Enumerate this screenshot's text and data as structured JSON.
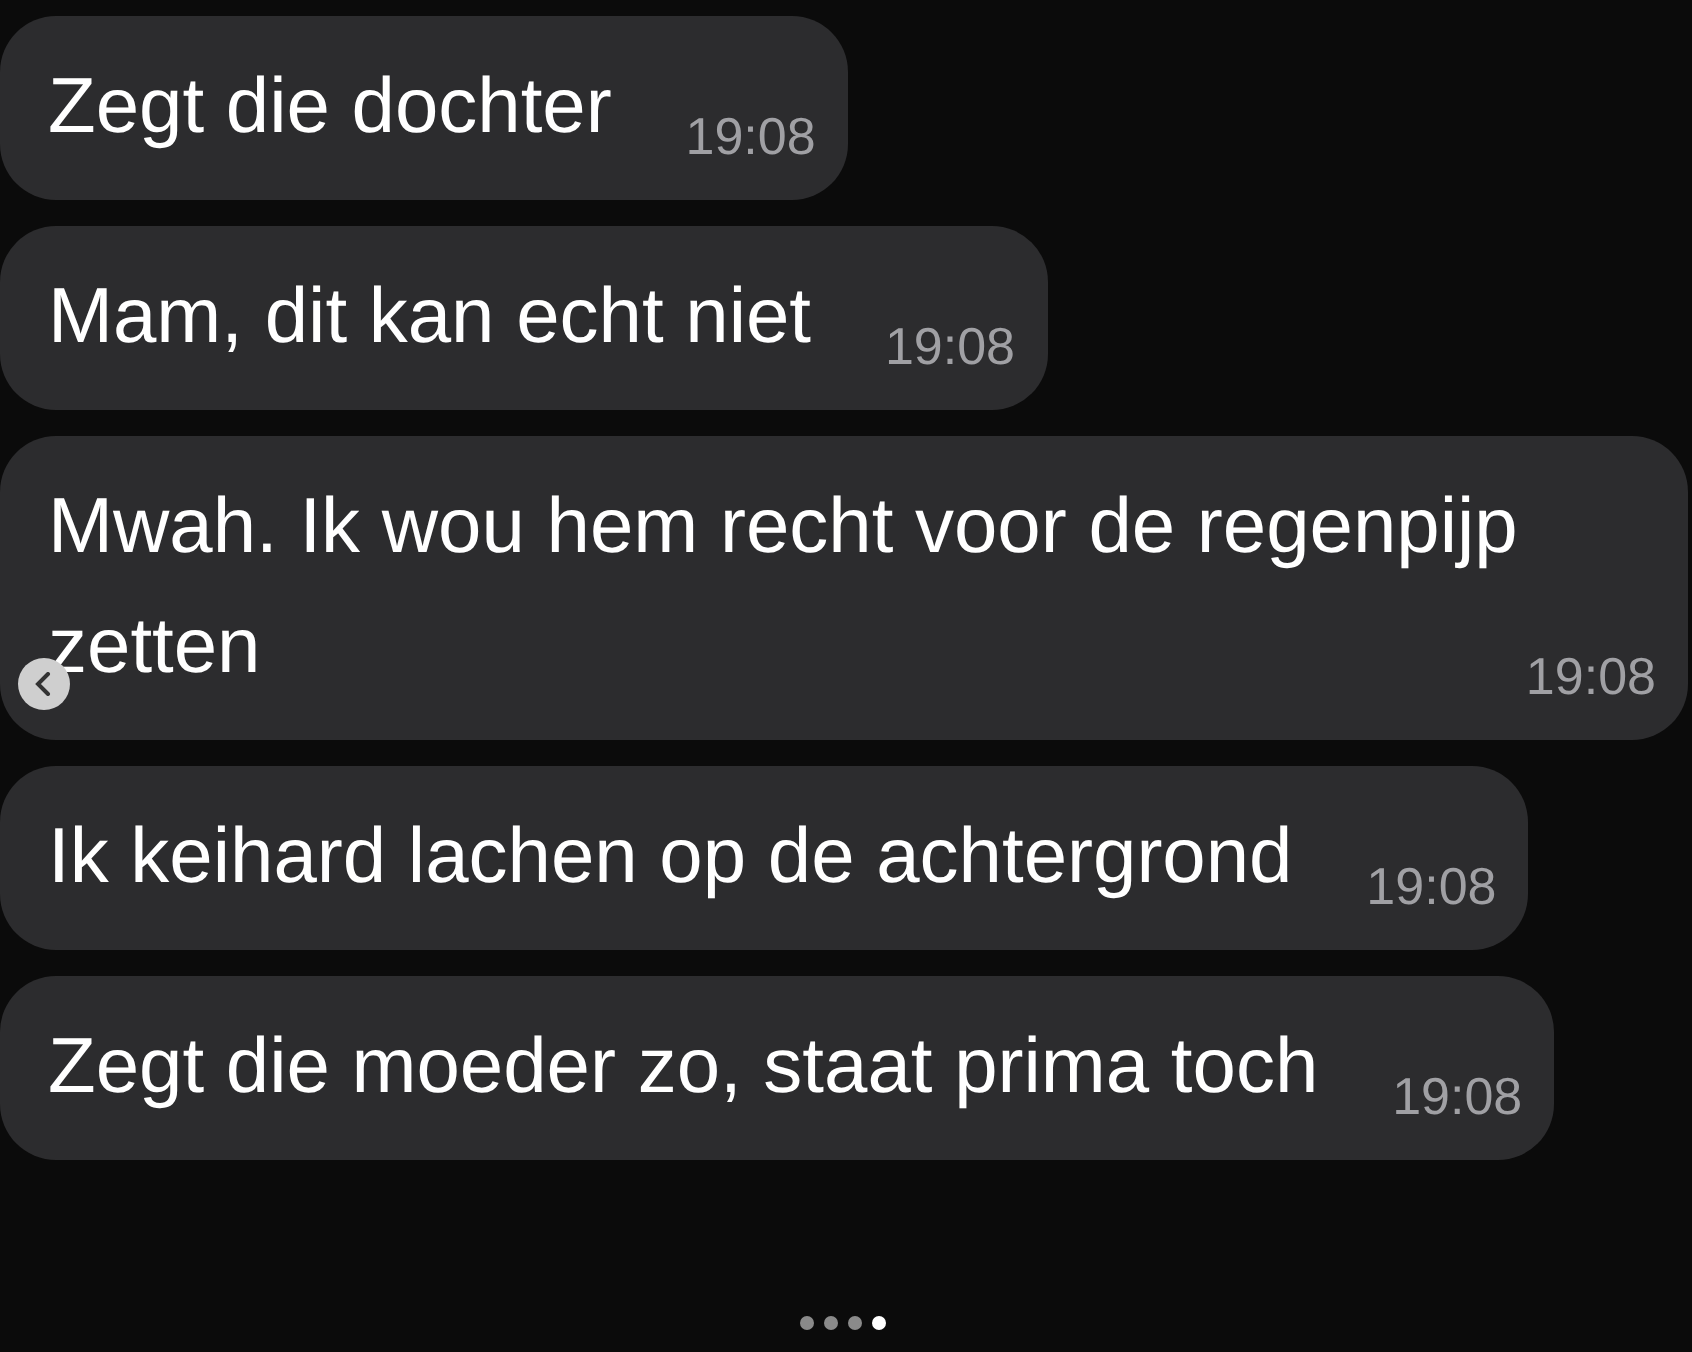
{
  "messages": [
    {
      "text": "Zegt die dochter",
      "time": "19:08"
    },
    {
      "text": "Mam, dit kan echt niet",
      "time": "19:08"
    },
    {
      "text": "Mwah. Ik wou hem recht voor de regenpijp zetten",
      "time": "19:08"
    },
    {
      "text": "Ik keihard lachen op de achtergrond",
      "time": "19:08"
    },
    {
      "text": "Zegt die moeder zo, staat prima toch",
      "time": "19:08"
    }
  ],
  "carousel": {
    "dots": [
      {
        "selected": false
      },
      {
        "selected": false
      },
      {
        "selected": false
      },
      {
        "selected": true
      }
    ]
  }
}
